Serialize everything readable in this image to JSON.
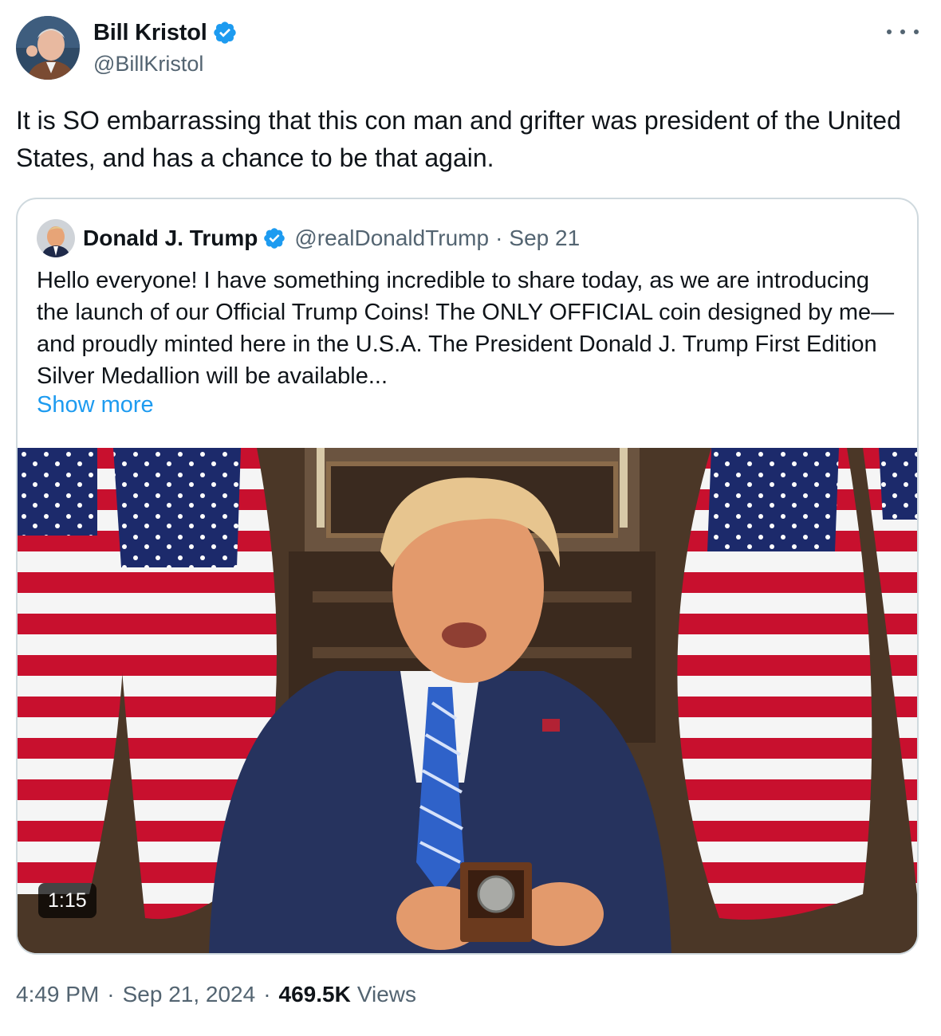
{
  "tweet": {
    "author_name": "Bill Kristol",
    "author_handle": "@BillKristol",
    "verified_icon": "verified-badge-icon",
    "more_icon": "more-options-icon",
    "text": "It is SO embarrassing that this con man and grifter was president of the United States, and has a chance to be that again.",
    "time": "4:49 PM",
    "date": "Sep 21, 2024",
    "separator": "·",
    "views_count": "469.5K",
    "views_label": "Views"
  },
  "quoted": {
    "author_name": "Donald J. Trump",
    "author_handle": "@realDonaldTrump",
    "separator": "·",
    "date": "Sep 21",
    "text": "Hello everyone! I have something incredible to share today, as we are introducing the launch of our Official Trump Coins! The ONLY OFFICIAL coin designed by me—and proudly minted here in the U.S.A. The President Donald J. Trump First Edition Silver Medallion will be available...",
    "show_more": "Show more",
    "video_duration": "1:15"
  },
  "colors": {
    "accent": "#1d9bf0",
    "secondary_text": "#536471",
    "border": "#cfd9de"
  }
}
